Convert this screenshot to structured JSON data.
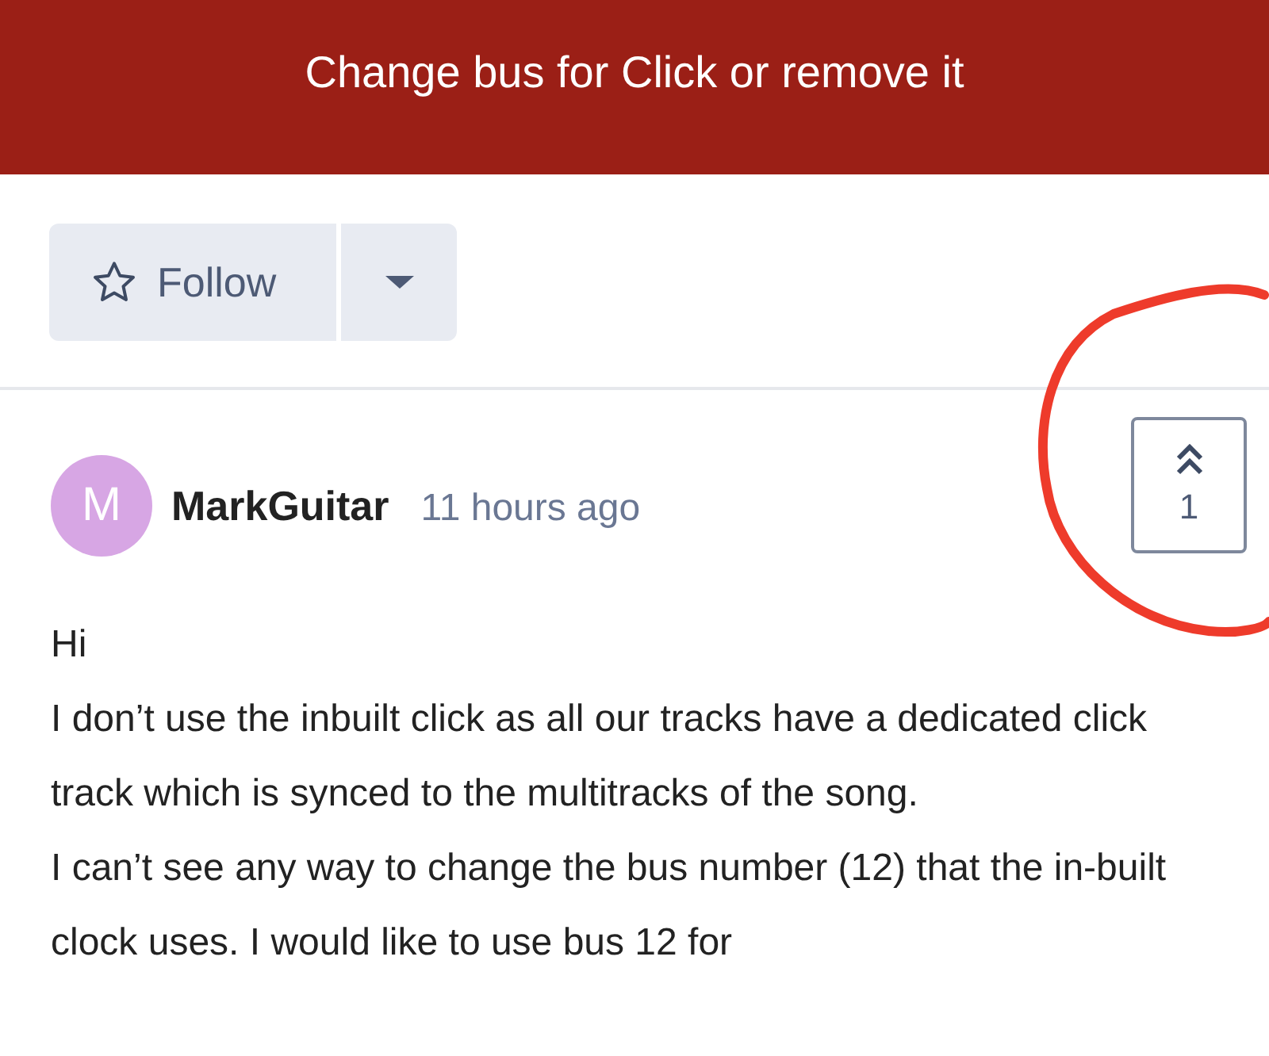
{
  "header": {
    "title": "Change bus for Click or remove it"
  },
  "follow_button": {
    "label": "Follow"
  },
  "post": {
    "author": {
      "initial": "M",
      "name": "MarkGuitar"
    },
    "time": "11 hours ago",
    "votes": {
      "count": "1"
    },
    "paragraphs": [
      "Hi",
      "I don’t use the inbuilt click as all our tracks have a dedicated click track which is synced to the multitracks of the song.",
      "I can’t see any way to change the bus number (12) that the in-built clock uses. I would like to use bus 12 for"
    ]
  }
}
